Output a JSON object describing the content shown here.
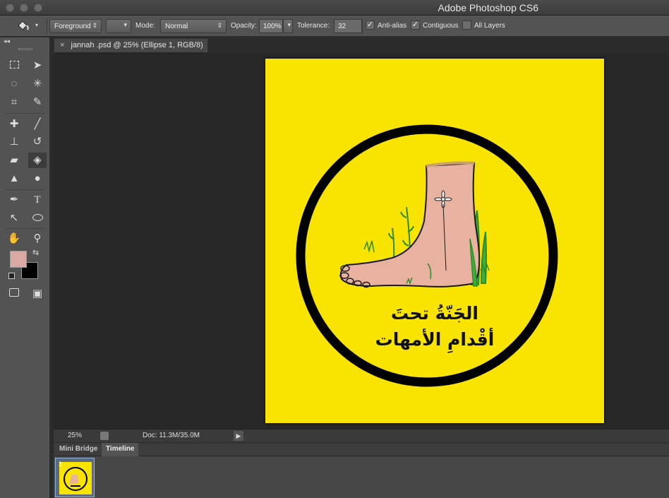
{
  "window": {
    "title": "Adobe Photoshop CS6"
  },
  "options_bar": {
    "fill_source": "Foreground",
    "mode_label": "Mode:",
    "mode_value": "Normal",
    "opacity_label": "Opacity:",
    "opacity_value": "100%",
    "tolerance_label": "Tolerance:",
    "tolerance_value": "32",
    "anti_alias_label": "Anti-alias",
    "anti_alias_checked": true,
    "contiguous_label": "Contiguous",
    "contiguous_checked": true,
    "all_layers_label": "All Layers",
    "all_layers_checked": false
  },
  "document": {
    "tab_title": "jannah .psd @ 25% (Ellipse 1, RGB/8)",
    "background_color": "#f9e300",
    "arabic_line1": "الجَنّةُ تحتَ",
    "arabic_line2": "أقْدامِ الأمهات"
  },
  "status_bar": {
    "zoom": "25%",
    "doc_size": "Doc: 11.3M/35.0M"
  },
  "colors": {
    "foreground": "#d9a9a2",
    "background": "#000000"
  },
  "bottom_panel": {
    "tabs": [
      "Mini Bridge",
      "Timeline"
    ],
    "active_tab": "Timeline",
    "frames": [
      {
        "number": "1"
      }
    ]
  }
}
